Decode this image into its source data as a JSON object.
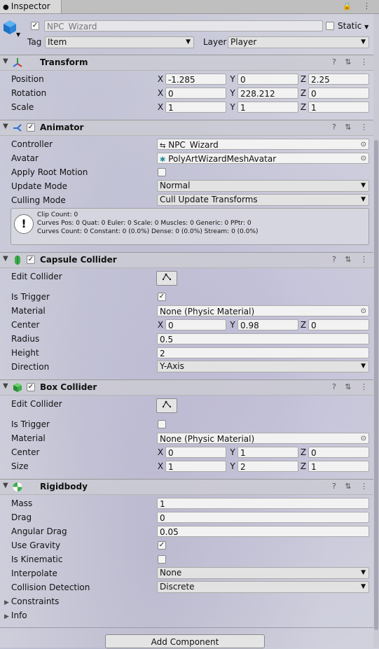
{
  "window": {
    "tab_label": "Inspector",
    "tab_icons": "⋮"
  },
  "gameobject": {
    "active_checked": true,
    "name": "NPC_Wizard",
    "static_label": "Static",
    "tag_label": "Tag",
    "tag_value": "Item",
    "layer_label": "Layer",
    "layer_value": "Player"
  },
  "transform": {
    "title": "Transform",
    "position_label": "Position",
    "position": {
      "x": "-1.285",
      "y": "0",
      "z": "2.25"
    },
    "rotation_label": "Rotation",
    "rotation": {
      "x": "0",
      "y": "228.212",
      "z": "0"
    },
    "scale_label": "Scale",
    "scale": {
      "x": "1",
      "y": "1",
      "z": "1"
    }
  },
  "axes": {
    "x": "X",
    "y": "Y",
    "z": "Z"
  },
  "animator": {
    "title": "Animator",
    "controller_label": "Controller",
    "controller_value": "NPC_Wizard",
    "avatar_label": "Avatar",
    "avatar_value": "PolyArtWizardMeshAvatar",
    "apply_root_motion_label": "Apply Root Motion",
    "update_mode_label": "Update Mode",
    "update_mode_value": "Normal",
    "culling_mode_label": "Culling Mode",
    "culling_mode_value": "Cull Update Transforms",
    "info_lines": [
      "Clip Count: 0",
      "Curves Pos: 0 Quat: 0 Euler: 0 Scale: 0 Muscles: 0 Generic: 0 PPtr: 0",
      "Curves Count: 0 Constant: 0 (0.0%) Dense: 0 (0.0%) Stream: 0 (0.0%)"
    ]
  },
  "capsule_collider": {
    "title": "Capsule Collider",
    "edit_collider_label": "Edit Collider",
    "is_trigger_label": "Is Trigger",
    "material_label": "Material",
    "material_value": "None (Physic Material)",
    "center_label": "Center",
    "center": {
      "x": "0",
      "y": "0.98",
      "z": "0"
    },
    "radius_label": "Radius",
    "radius_value": "0.5",
    "height_label": "Height",
    "height_value": "2",
    "direction_label": "Direction",
    "direction_value": "Y-Axis"
  },
  "box_collider": {
    "title": "Box Collider",
    "edit_collider_label": "Edit Collider",
    "is_trigger_label": "Is Trigger",
    "material_label": "Material",
    "material_value": "None (Physic Material)",
    "center_label": "Center",
    "center": {
      "x": "0",
      "y": "1",
      "z": "0"
    },
    "size_label": "Size",
    "size": {
      "x": "1",
      "y": "2",
      "z": "1"
    }
  },
  "rigidbody": {
    "title": "Rigidbody",
    "mass_label": "Mass",
    "mass_value": "1",
    "drag_label": "Drag",
    "drag_value": "0",
    "angular_drag_label": "Angular Drag",
    "angular_drag_value": "0.05",
    "use_gravity_label": "Use Gravity",
    "is_kinematic_label": "Is Kinematic",
    "interpolate_label": "Interpolate",
    "interpolate_value": "None",
    "collision_detection_label": "Collision Detection",
    "collision_detection_value": "Discrete",
    "constraints_label": "Constraints",
    "info_label": "Info"
  },
  "add_component_label": "Add Component",
  "header_icons": "? ⇅ ⋮",
  "check_mark": "✓"
}
